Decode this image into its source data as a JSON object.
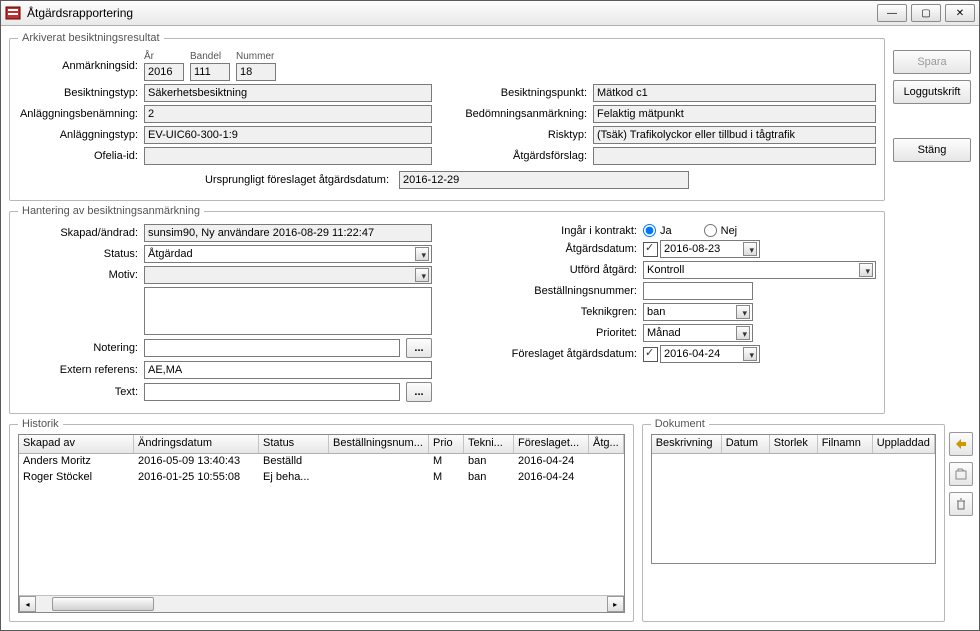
{
  "window": {
    "title": "Åtgärdsrapportering"
  },
  "buttons": {
    "save": "Spara",
    "log": "Loggutskrift",
    "close": "Stäng"
  },
  "arkiv": {
    "legend": "Arkiverat besiktningsresultat",
    "hdr": {
      "ar": "År",
      "bandel": "Bandel",
      "nummer": "Nummer"
    },
    "lbl": {
      "anmid": "Anmärkningsid:",
      "btyp": "Besiktningstyp:",
      "anlben": "Anläggningsbenämning:",
      "anltyp": "Anläggningstyp:",
      "ofelia": "Ofelia-id:",
      "bpunkt": "Besiktningspunkt:",
      "bedom": "Bedömningsanmärkning:",
      "risk": "Risktyp:",
      "atgforslag": "Åtgärdsförslag:",
      "urspr": "Ursprungligt föreslaget åtgärdsdatum:"
    },
    "val": {
      "ar": "2016",
      "bandel": "111",
      "nummer": "18",
      "btyp": "Säkerhetsbesiktning",
      "anlben": "2",
      "anltyp": "EV-UIC60-300-1:9",
      "ofelia": "",
      "bpunkt": "Mätkod c1",
      "bedom": "Felaktig mätpunkt",
      "risk": "(Tsäk) Trafikolyckor eller tillbud i tågtrafik",
      "atgforslag": "",
      "urspr": "2016-12-29"
    }
  },
  "hant": {
    "legend": "Hantering av besiktningsanmärkning",
    "lbl": {
      "skapad": "Skapad/ändrad:",
      "status": "Status:",
      "motiv": "Motiv:",
      "notering": "Notering:",
      "extref": "Extern referens:",
      "text": "Text:",
      "kontrakt": "Ingår i kontrakt:",
      "ja": "Ja",
      "nej": "Nej",
      "atgdatum": "Åtgärdsdatum:",
      "utford": "Utförd åtgärd:",
      "bestnr": "Beställningsnummer:",
      "teknik": "Teknikgren:",
      "prio": "Prioritet:",
      "foreslag": "Föreslaget åtgärdsdatum:"
    },
    "val": {
      "skapad": "sunsim90, Ny användare  2016-08-29 11:22:47",
      "status": "Åtgärdad",
      "motiv": "",
      "notering": "",
      "extref": "AE,MA",
      "text": "",
      "kontrakt_ja": true,
      "atgdatum": "2016-08-23",
      "utford": "Kontroll",
      "bestnr": "",
      "teknik": "ban",
      "prio": "Månad",
      "foreslag": "2016-04-24"
    }
  },
  "historik": {
    "legend": "Historik",
    "cols": [
      "Skapad av",
      "Ändringsdatum",
      "Status",
      "Beställningsnum...",
      "Prio",
      "Tekni...",
      "Föreslaget...",
      "Åtg..."
    ],
    "rows": [
      {
        "skapad": "Anders Moritz",
        "datum": "2016-05-09 13:40:43",
        "status": "Beställd",
        "best": "",
        "prio": "M",
        "tek": "ban",
        "fore": "2016-04-24",
        "atg": ""
      },
      {
        "skapad": "Roger Stöckel",
        "datum": "2016-01-25 10:55:08",
        "status": "Ej beha...",
        "best": "",
        "prio": "M",
        "tek": "ban",
        "fore": "2016-04-24",
        "atg": ""
      }
    ]
  },
  "dokument": {
    "legend": "Dokument",
    "cols": [
      "Beskrivning",
      "Datum",
      "Storlek",
      "Filnamn",
      "Uppladdad"
    ]
  }
}
